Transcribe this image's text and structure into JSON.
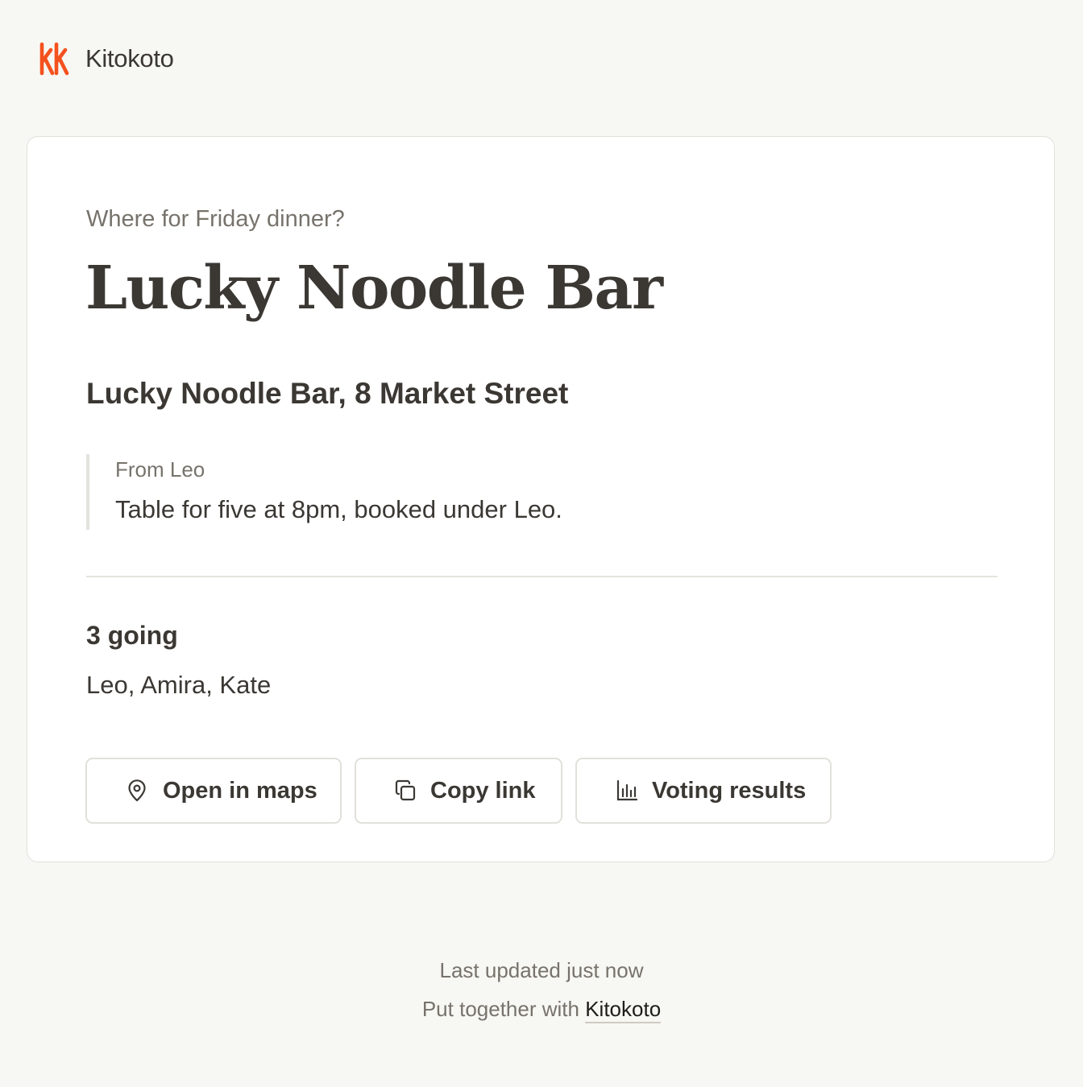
{
  "header": {
    "brand_name": "Kitokoto",
    "logo_icon": "kk-logo-icon",
    "logo_color": "#f4511e"
  },
  "card": {
    "question": "Where for Friday dinner?",
    "title": "Lucky Noodle Bar",
    "address": "Lucky Noodle Bar, 8 Market Street",
    "note": {
      "from": "From Leo",
      "text": "Table for five at 8pm, booked under Leo."
    },
    "attendance": {
      "count_label": "3 going",
      "names": "Leo, Amira, Kate"
    },
    "actions": [
      {
        "label": "Open in maps",
        "icon": "map-pin-icon"
      },
      {
        "label": "Copy link",
        "icon": "copy-icon"
      },
      {
        "label": "Voting results",
        "icon": "bar-chart-icon"
      }
    ]
  },
  "footer": {
    "updated": "Last updated just now",
    "credit_prefix": "Put together with",
    "credit_link": "Kitokoto"
  },
  "colors": {
    "background": "#f7f7f3",
    "card": "#ffffff",
    "text": "#3b3834",
    "muted": "#77736c",
    "border": "#e2e0da",
    "accent": "#f4511e"
  }
}
